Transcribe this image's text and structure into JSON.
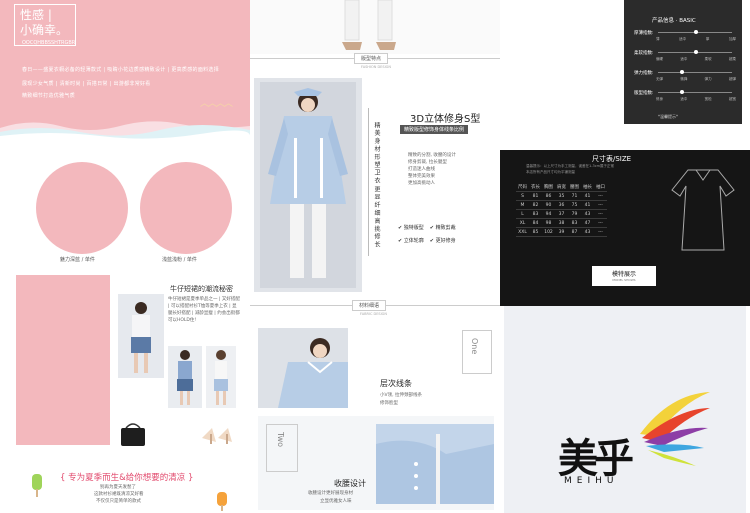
{
  "col1": {
    "hero_title_line1": "性感 |",
    "hero_title_line2": "小确幸。",
    "hero_sub": "OOCQHBBSSHTRGBR",
    "hero_p1": "春日——盛夏衣橱必备的轻薄款式 | 吸睛小花边质感精致设计 | 更高质感的面料选择",
    "hero_p2": "展现少女气质 | 清新时尚 | 百搭日常 | 出游都非常好看",
    "hero_p3": "精致细节打造优雅气质",
    "circle1_caption": "魅力深蓝 / 单件",
    "circle2_caption": "浅蓝浅粉 / 单件",
    "section_title": "牛仔短裙的潮流秘密",
    "section_text": "牛仔短裙是夏季单品之一 | 又好搭配 | 可以搭配衬衫T恤等夏季上衣 | 显腿长好搭配 | 减龄显瘦 | 约会出街都可以HOLD住!",
    "bottom_title": "{ 专为夏季而生&给你想要的清凉 }",
    "bottom_text1": "别再为夏天发愁了",
    "bottom_text2": "这款衬衫裙既清凉又好看",
    "bottom_text3": "不仅仅只是简单的款式"
  },
  "col2": {
    "label1": "版型特点",
    "label1_sub": "FASHION DESIGN",
    "vtext1": "精 美 身 材 形 塑 卫 衣",
    "vtext2": "更 显 纤 细 高 挑 修 长",
    "title_3d": "3D立体修身S型",
    "sub_3d": "精致版型修饰身体线条比例",
    "desc_lines": [
      "精致的分割, 收腰的设计",
      "修身剪裁, 拉长腿型",
      "打造迷人曲线",
      "整体完美效果",
      "更加高挑动人"
    ],
    "features": [
      "独特版型",
      "精致剪裁",
      "立体轮廓",
      "更好修身"
    ],
    "label2": "材料细语",
    "label2_sub": "FABRIC DESIGN",
    "one_label": "One",
    "one_title": "层次线条",
    "one_text1": "小V领, 拉伸颈部线条",
    "one_text2": "修饰脸型",
    "two_label": "Two",
    "two_title": "收腰设计",
    "two_text1": "收腰设计更好展现身材",
    "two_text2": "立显优雅女人味"
  },
  "col3": {
    "basic_title": "产品信息 · BASIC",
    "basic_rows": [
      {
        "label": "厚薄指数:",
        "opts": [
          "薄",
          "适中",
          "厚",
          "加厚"
        ]
      },
      {
        "label": "柔软指数:",
        "opts": [
          "偏硬",
          "适中",
          "柔软",
          "超柔"
        ]
      },
      {
        "label": "弹力指数:",
        "opts": [
          "无弹",
          "微弹",
          "弹力",
          "超弹"
        ]
      },
      {
        "label": "版型指数:",
        "opts": [
          "修身",
          "适中",
          "宽松",
          "超宽"
        ]
      }
    ],
    "basic_note": "*温馨提示*",
    "size_title": "尺寸表/SIZE",
    "size_note1": "温馨提示：以上尺寸为手工测量，误差在1-3cm属于正常",
    "size_note2": "本店所有产品尺寸均为平铺测量",
    "size_headers": [
      "尺码",
      "衣长",
      "胸围",
      "肩宽",
      "腰围",
      "袖长",
      "袖口"
    ],
    "size_rows": [
      [
        "S",
        "81",
        "86",
        "35",
        "71",
        "41",
        "---"
      ],
      [
        "M",
        "82",
        "90",
        "36",
        "75",
        "41",
        "---"
      ],
      [
        "L",
        "83",
        "94",
        "37",
        "79",
        "43",
        "---"
      ],
      [
        "XL",
        "84",
        "98",
        "38",
        "83",
        "47",
        "---"
      ],
      [
        "XXL",
        "85",
        "102",
        "39",
        "87",
        "43",
        "---"
      ]
    ],
    "model_btn": "模特展示",
    "model_btn_sub": "MODEL SHOWS",
    "logo_text": "美乎",
    "logo_sub": "MEIHU"
  },
  "colors": {
    "pink": "#f3b8bd",
    "accent_red": "#e24a6d",
    "dark": "#151515",
    "light_blue": "#b7cde6"
  }
}
